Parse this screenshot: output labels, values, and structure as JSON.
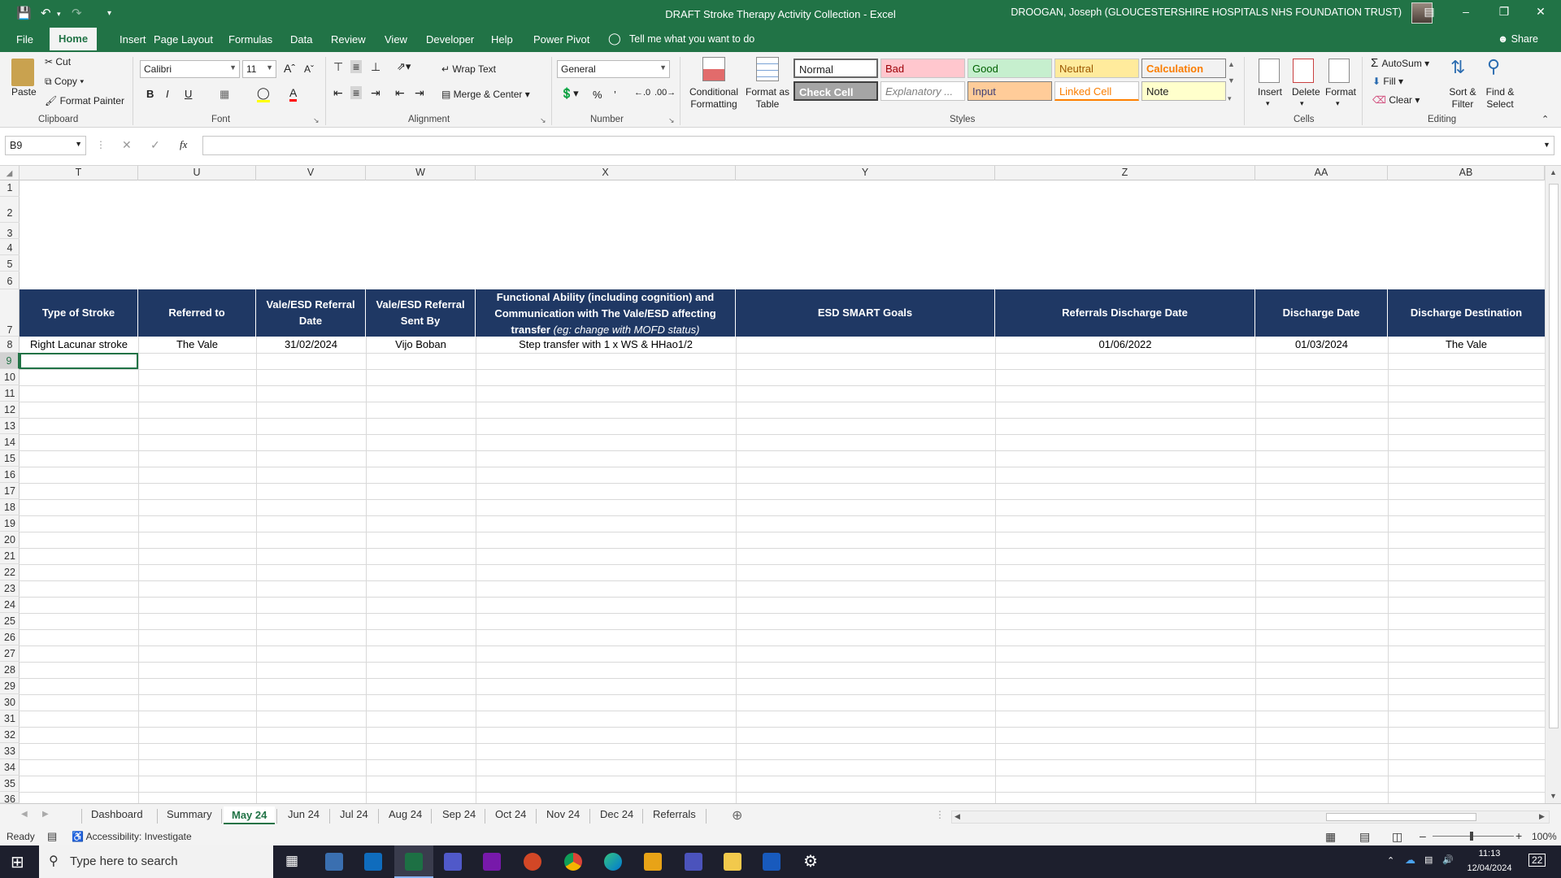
{
  "window": {
    "title": "DRAFT Stroke Therapy Activity Collection  -  Excel",
    "user": "DROOGAN, Joseph (GLOUCESTERSHIRE HOSPITALS NHS FOUNDATION TRUST)",
    "share": "Share"
  },
  "ribbon_tabs": [
    "File",
    "Home",
    "Insert",
    "Page Layout",
    "Formulas",
    "Data",
    "Review",
    "View",
    "Developer",
    "Help",
    "Power Pivot"
  ],
  "tell_me": "Tell me what you want to do",
  "clipboard": {
    "paste": "Paste",
    "cut": "Cut",
    "copy": "Copy",
    "format_painter": "Format Painter",
    "label": "Clipboard"
  },
  "font": {
    "name": "Calibri",
    "size": "11",
    "label": "Font"
  },
  "alignment": {
    "wrap": "Wrap Text",
    "merge": "Merge & Center",
    "label": "Alignment"
  },
  "number": {
    "format": "General",
    "label": "Number"
  },
  "styles": {
    "conditional": "Conditional Formatting",
    "format_table": "Format as Table",
    "label": "Styles",
    "cells": [
      "Normal",
      "Bad",
      "Good",
      "Neutral",
      "Calculation",
      "Check Cell",
      "Explanatory ...",
      "Input",
      "Linked Cell",
      "Note"
    ]
  },
  "cells_grp": {
    "insert": "Insert",
    "delete": "Delete",
    "format": "Format",
    "label": "Cells"
  },
  "editing": {
    "autosum": "AutoSum",
    "fill": "Fill",
    "clear": "Clear",
    "sort": "Sort & Filter",
    "find": "Find & Select",
    "label": "Editing"
  },
  "name_box": "B9",
  "columns": [
    "T",
    "U",
    "V",
    "W",
    "X",
    "Y",
    "Z",
    "AA",
    "AB"
  ],
  "rows": [
    "1",
    "2",
    "3",
    "4",
    "5",
    "6",
    "7",
    "8",
    "9",
    "10",
    "11",
    "12",
    "13",
    "14",
    "15",
    "16",
    "17",
    "18",
    "19",
    "20",
    "21",
    "22",
    "23",
    "24",
    "25",
    "26",
    "27",
    "28",
    "29",
    "30",
    "31",
    "32",
    "33",
    "34",
    "35",
    "36"
  ],
  "table_headers": [
    "Type of Stroke",
    "Referred to",
    "Vale/ESD Referral Date",
    "Vale/ESD Referral Sent By",
    "Functional Ability (including cognition) and Communication with The Vale/ESD affecting transfer",
    "ESD SMART Goals",
    "Referrals Discharge Date",
    "Discharge Date",
    "Discharge Destination"
  ],
  "header_note": "(eg: change with MOFD status)",
  "row8": [
    "Right Lacunar stroke",
    "The Vale",
    "31/02/2024",
    "Vijo Boban",
    "Step transfer with 1 x WS & HHao1/2",
    "",
    "01/06/2022",
    "01/03/2024",
    "The Vale"
  ],
  "sheet_tabs": [
    "Dashboard",
    "Summary",
    "May 24",
    "Jun 24",
    "Jul 24",
    "Aug 24",
    "Sep 24",
    "Oct 24",
    "Nov 24",
    "Dec 24",
    "Referrals"
  ],
  "active_sheet": "May 24",
  "status": {
    "ready": "Ready",
    "accessibility": "Accessibility: Investigate",
    "zoom": "100%"
  },
  "taskbar": {
    "search": "Type here to search",
    "time": "11:13",
    "date": "12/04/2024",
    "notif": "22"
  }
}
